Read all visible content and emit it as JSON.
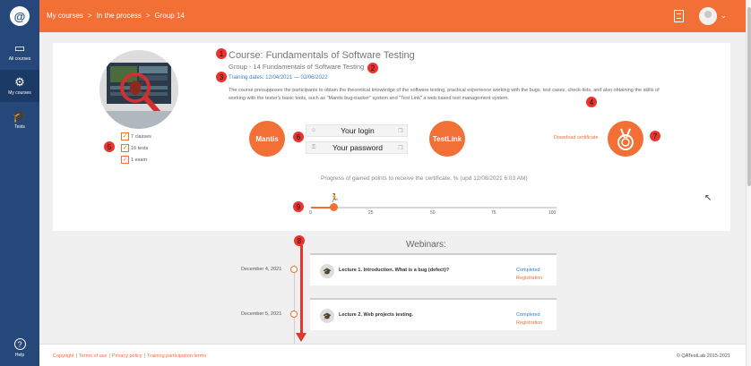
{
  "sidebar": {
    "logo": "@",
    "items": [
      {
        "label": "All courses",
        "icon": "book-icon",
        "glyph": "▭"
      },
      {
        "label": "My courses",
        "icon": "gear-icon",
        "glyph": "⚙"
      },
      {
        "label": "Tests",
        "icon": "graduation-cap-icon",
        "glyph": "🎓"
      }
    ],
    "help": {
      "label": "Help",
      "glyph": "?"
    }
  },
  "header": {
    "breadcrumb": [
      "My courses",
      "In the process",
      "Group 14"
    ],
    "separator": ">",
    "chevron": "⌄"
  },
  "course": {
    "title": "Course: Fundamentals of Software Testing",
    "group": "Group - 14 Fundamentals of Software Testing",
    "dates": "Training dates: 12/04/2021 — 02/06/2022",
    "description": "The course presupposes the participants to obtain the theoretical knowledge of the software testing, practical experience working with the bugs, test cases, check-lists, and also obtaining the skills of working with the tester's basic tools, such as \"Mantis bug-tracker\" system and \"Test Link\" a web based test management system.",
    "checklist": [
      "7 classes",
      "16 tests",
      "1 exam"
    ],
    "tools": {
      "mantis": "Mantis",
      "testlink": "TestLink"
    },
    "login_value": "Your login",
    "password_value": "Your password",
    "download_certificate": "Download certificate",
    "progress": {
      "title": "Progress of gained points to receive the certificate, % (upd 12/08/2021 6:03 AM)",
      "value": 9,
      "ticks": [
        "0",
        "25",
        "50",
        "75",
        "100"
      ]
    }
  },
  "webinars": {
    "title": "Webinars:",
    "items": [
      {
        "date": "December 4, 2021",
        "name": "Lecture 1. Introduction. What is a bug (defect)?",
        "status": "Completed",
        "action": "Registration"
      },
      {
        "date": "December 5, 2021",
        "name": "Lecture 2. Web projects testing.",
        "status": "Completed",
        "action": "Registration"
      }
    ]
  },
  "footer": {
    "links": [
      "Copyright",
      "Terms of use",
      "Privacy policy",
      "Training participation terms"
    ],
    "copyright": "© QATestLab 2015-2021"
  },
  "annotations": [
    "1",
    "2",
    "3",
    "4",
    "5",
    "6",
    "7",
    "8",
    "9",
    "8"
  ],
  "colors": {
    "accent": "#f26f36",
    "sidebar": "#25477a",
    "annotation": "#e8332f",
    "link": "#3b7fc4"
  }
}
